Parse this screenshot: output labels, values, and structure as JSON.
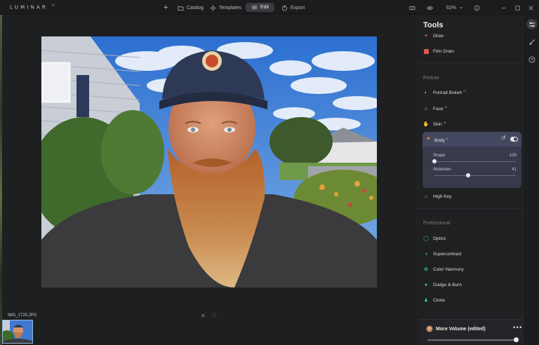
{
  "app": {
    "logo": "LUMINAR",
    "logo_version": "AI"
  },
  "toolbar": {
    "add_label": "+",
    "catalog_label": "Catalog",
    "templates_label": "Templates",
    "edit_label": "Edit",
    "export_label": "Export",
    "zoom_value": "62%"
  },
  "canvas": {
    "photo_alt": "Portrait photo of bearded man in cap"
  },
  "filmstrip": {
    "filename": "IMG_1725.JPG"
  },
  "panel": {
    "title": "Tools",
    "tools_top": [
      {
        "label": "Glow",
        "sup": ""
      },
      {
        "label": "Film Grain",
        "sup": ""
      }
    ],
    "portrait_section": "Portrait",
    "portrait_tools": [
      {
        "label": "Portrait Bokeh",
        "sup": "AI"
      },
      {
        "label": "Face",
        "sup": "AI"
      },
      {
        "label": "Skin",
        "sup": "AI"
      }
    ],
    "body_tool": {
      "label": "Body",
      "sup": "AI",
      "sliders": [
        {
          "label": "Shape",
          "value": "-100",
          "fraction": 0.0
        },
        {
          "label": "Abdomen",
          "value": "41",
          "fraction": 0.41
        }
      ]
    },
    "high_key_label": "High Key",
    "professional_section": "Professional",
    "professional_tools": [
      {
        "label": "Optics"
      },
      {
        "label": "Supercontrast"
      },
      {
        "label": "Color Harmony"
      },
      {
        "label": "Dodge & Burn"
      },
      {
        "label": "Clone"
      }
    ]
  },
  "preset": {
    "name": "More Volume (edited)",
    "dots": "•••",
    "amount": 1.0
  },
  "colors": {
    "accent_panel": "#434760",
    "body_card": "#373a4a"
  }
}
